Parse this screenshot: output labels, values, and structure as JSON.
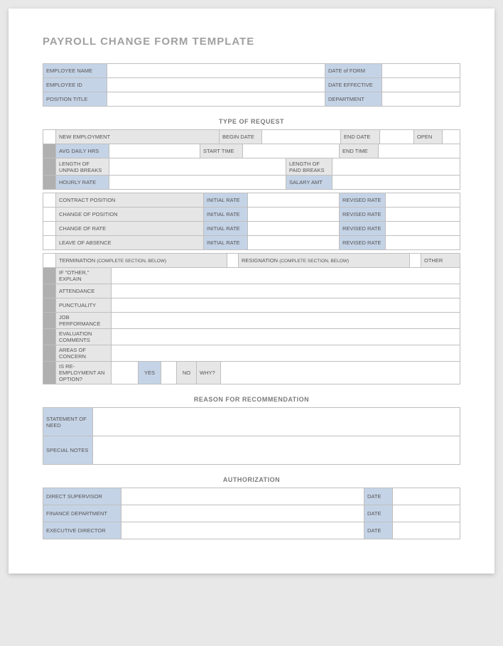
{
  "title": "PAYROLL CHANGE FORM TEMPLATE",
  "employee": {
    "name_label": "EMPLOYEE NAME",
    "id_label": "EMPLOYEE ID",
    "position_label": "POSITION TITLE",
    "date_form_label": "DATE of FORM",
    "date_effective_label": "DATE EFFECTIVE",
    "department_label": "DEPARTMENT"
  },
  "type_of_request": {
    "heading": "TYPE OF REQUEST",
    "new_employment": "NEW EMPLOYMENT",
    "begin_date": "BEGIN DATE",
    "end_date": "END DATE",
    "open": "OPEN",
    "avg_daily_hrs": "AVG DAILY HRS",
    "start_time": "START TIME",
    "end_time": "END TIME",
    "length_unpaid": "LENGTH OF UNPAID BREAKS",
    "length_paid": "LENGTH OF PAID BREAKS",
    "hourly_rate": "HOURLY RATE",
    "salary_amt": "SALARY AMT",
    "contract_position": "CONTRACT POSITION",
    "change_position": "CHANGE OF POSITION",
    "change_rate": "CHANGE OF RATE",
    "leave_absence": "LEAVE OF ABSENCE",
    "initial_rate": "INITIAL RATE",
    "revised_rate": "REVISED RATE",
    "termination": "TERMINATION",
    "termination_note": "(COMPLETE SECTION, BELOW)",
    "resignation": "RESIGNATION",
    "resignation_note": "(COMPLETE SECTION, BELOW)",
    "other": "OTHER",
    "if_other": "IF \"OTHER,\" EXPLAIN",
    "attendance": "ATTENDANCE",
    "punctuality": "PUNCTUALITY",
    "job_performance": "JOB PERFORMANCE",
    "evaluation_comments": "EVALUATION COMMENTS",
    "areas_concern": "AREAS OF CONCERN",
    "reemployment": "IS RE-EMPLOYMENT AN OPTION?",
    "yes": "YES",
    "no": "NO",
    "why": "WHY?"
  },
  "reason": {
    "heading": "REASON FOR RECOMMENDATION",
    "statement": "STATEMENT OF NEED",
    "special_notes": "SPECIAL NOTES"
  },
  "authorization": {
    "heading": "AUTHORIZATION",
    "direct_supervisor": "DIRECT SUPERVISOR",
    "finance_department": "FINANCE DEPARTMENT",
    "executive_director": "EXECUTIVE DIRECTOR",
    "date": "DATE"
  }
}
